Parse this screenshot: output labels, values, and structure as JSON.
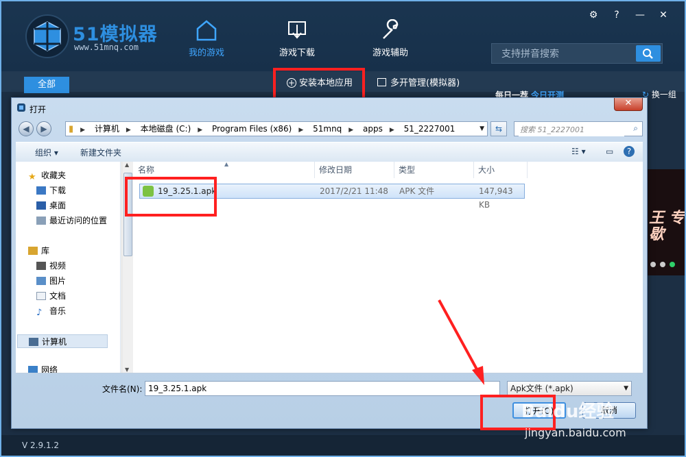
{
  "app": {
    "brand": "51模拟器",
    "url": "www.51mnq.com",
    "nav": [
      {
        "label": "我的游戏",
        "icon": "home-icon"
      },
      {
        "label": "游戏下载",
        "icon": "download-icon"
      },
      {
        "label": "游戏辅助",
        "icon": "wrench-icon"
      }
    ],
    "top_icons": [
      "settings-icon",
      "help-icon",
      "minimize-icon",
      "close-icon"
    ],
    "top_glyphs": {
      "settings": "⚙",
      "help": "?",
      "minimize": "—",
      "close": "✕"
    },
    "search_placeholder": "支持拼音搜索",
    "tab_all": "全部",
    "install_local": "安装本地应用",
    "multi_open": "多开管理(模拟器)",
    "daily_pick": "每日一荐",
    "today_open": "今日开测",
    "refresh_batch": "换一组",
    "banner_text": "王 专歇",
    "version": "V 2.9.1.2"
  },
  "dialog": {
    "title": "打开",
    "close_glyph": "✕",
    "path": [
      "计算机",
      "本地磁盘 (C:)",
      "Program Files (x86)",
      "51mnq",
      "apps",
      "51_2227001"
    ],
    "search_placeholder": "搜索 51_2227001",
    "toolbar": {
      "organize": "组织 ▾",
      "new_folder": "新建文件夹"
    },
    "sidebar": [
      {
        "label": "收藏夹",
        "icon": "star-icon"
      },
      {
        "label": "下载",
        "icon": "downloads-folder-icon"
      },
      {
        "label": "桌面",
        "icon": "desktop-icon"
      },
      {
        "label": "最近访问的位置",
        "icon": "recent-places-icon"
      },
      {
        "label": "库",
        "icon": "library-icon"
      },
      {
        "label": "视频",
        "icon": "video-icon"
      },
      {
        "label": "图片",
        "icon": "pictures-icon"
      },
      {
        "label": "文档",
        "icon": "documents-icon"
      },
      {
        "label": "音乐",
        "icon": "music-icon"
      },
      {
        "label": "计算机",
        "icon": "computer-icon"
      },
      {
        "label": "网络",
        "icon": "network-icon"
      }
    ],
    "columns": [
      "名称",
      "修改日期",
      "类型",
      "大小"
    ],
    "files": [
      {
        "name": "19_3.25.1.apk",
        "modified": "2017/2/21 11:48",
        "type": "APK 文件",
        "size": "147,943 KB"
      }
    ],
    "filename_label": "文件名(N):",
    "filename_value": "19_3.25.1.apk",
    "filetype": "Apk文件 (*.apk)",
    "open_button": "打开(O)",
    "cancel_button": "取消"
  },
  "watermark": {
    "brand": "Baidu经验",
    "url": "jingyan.baidu.com"
  },
  "colors": {
    "accent": "#2e8fe0",
    "highlight_box": "#ff2020",
    "title_bg": "#1a3550"
  }
}
